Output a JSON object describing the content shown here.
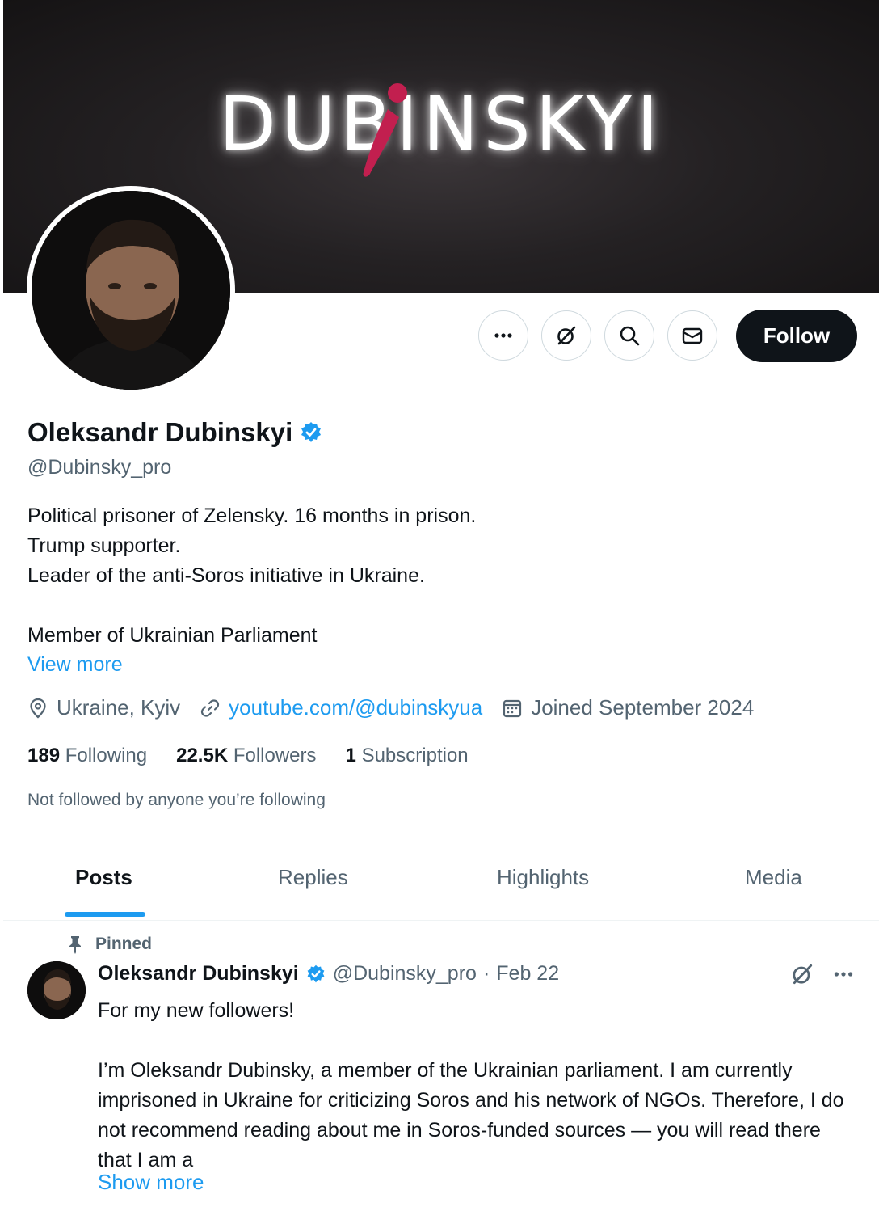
{
  "banner": {
    "logo_text": "DUBINSKYI"
  },
  "actions": {
    "more_icon": "more-icon",
    "grok_icon": "grok-icon",
    "search_icon": "search-icon",
    "message_icon": "envelope-icon",
    "follow_label": "Follow"
  },
  "profile": {
    "name": "Oleksandr Dubinskyi",
    "handle": "@Dubinsky_pro",
    "bio": "Political prisoner of Zelensky. 16 months in prison.\nTrump supporter.\nLeader of the anti-Soros initiative in Ukraine.\n\nMember of Ukrainian Parliament",
    "view_more": "View more",
    "location": "Ukraine, Kyiv",
    "link": "youtube.com/@dubinskyua",
    "joined": "Joined September 2024",
    "following_count": "189",
    "following_label": "Following",
    "followers_count": "22.5K",
    "followers_label": "Followers",
    "subscription_count": "1",
    "subscription_label": "Subscription",
    "not_followed": "Not followed by anyone you’re following"
  },
  "tabs": [
    {
      "label": "Posts"
    },
    {
      "label": "Replies"
    },
    {
      "label": "Highlights"
    },
    {
      "label": "Media"
    }
  ],
  "post": {
    "pinned_label": "Pinned",
    "author": "Oleksandr Dubinskyi",
    "handle": "@Dubinsky_pro",
    "separator": "·",
    "date": "Feb 22",
    "text": "For my new followers!\n\nI’m Oleksandr Dubinsky, a member of the Ukrainian parliament. I am currently imprisoned in Ukraine for criticizing Soros and his network of NGOs. Therefore, I do not recommend reading about me in Soros-funded sources — you will read there that I am a",
    "show_more": "Show more"
  },
  "colors": {
    "accent": "#1d9bf0",
    "text": "#0f1419",
    "muted": "#536471",
    "banner_i": "#c21f4f"
  }
}
